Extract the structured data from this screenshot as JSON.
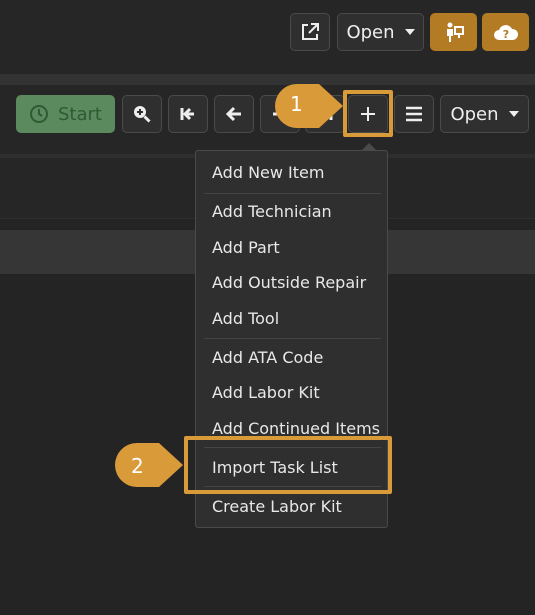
{
  "header": {
    "open_label": "Open"
  },
  "toolbar": {
    "start_label": "Start",
    "open_label": "Open"
  },
  "add_menu": {
    "items": [
      "Add New Item",
      "Add Technician",
      "Add Part",
      "Add Outside Repair",
      "Add Tool",
      "Add ATA Code",
      "Add Labor Kit",
      "Add Continued Items",
      "Import Task List",
      "Create Labor Kit"
    ]
  },
  "callouts": {
    "step1": "1",
    "step2": "2"
  },
  "colors": {
    "accent": "#b27b24",
    "highlight": "#d99a3a",
    "start_green": "#5a8a5e",
    "background": "#242424"
  },
  "icons": {
    "external": "external-link-icon",
    "assign": "assign-person-icon",
    "cloud_help": "cloud-question-icon",
    "clock": "clock-icon",
    "zoom": "zoom-icon",
    "first": "first-page-icon",
    "prev": "arrow-left-icon",
    "plus": "plus-icon",
    "menu": "hamburger-icon"
  }
}
